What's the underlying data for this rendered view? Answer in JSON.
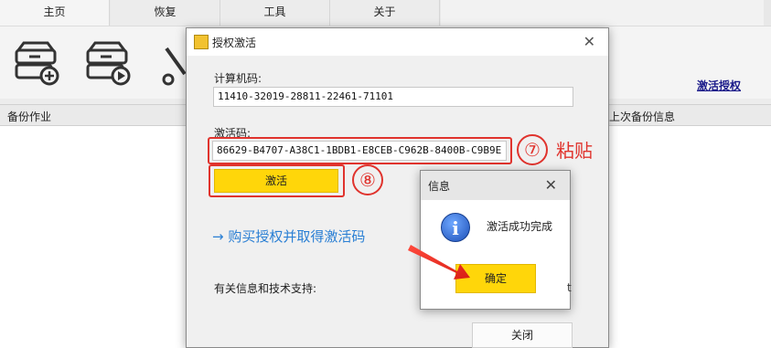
{
  "tabs": [
    "主页",
    "恢复",
    "工具",
    "关于"
  ],
  "toolbar": {
    "activate_link": "激活授权"
  },
  "list": {
    "col_job": "备份作业",
    "col_last": "上次备份信息"
  },
  "dialog": {
    "title": "授权激活",
    "machine_code_label": "计算机码:",
    "machine_code": "11410-32019-28811-22461-71101",
    "activation_code_label": "激活码:",
    "activation_code": "86629-B4707-A38C1-1BDB1-E8CEB-C962B-8400B-C9B9E",
    "activate_button": "激活",
    "buy_link": "→ 购买授权并取得激活码",
    "support_label": "有关信息和技术支持:",
    "close_button": "关闭"
  },
  "annotations": {
    "step7": "⑦",
    "paste": "粘贴",
    "step8": "⑧"
  },
  "msgbox": {
    "title": "信息",
    "message": "激活成功完成",
    "ok_button": "确定",
    "partial_text": "t"
  },
  "colors": {
    "accent_yellow": "#ffd60a",
    "annotation_red": "#e0332d",
    "link_blue": "#2a7fd4"
  }
}
